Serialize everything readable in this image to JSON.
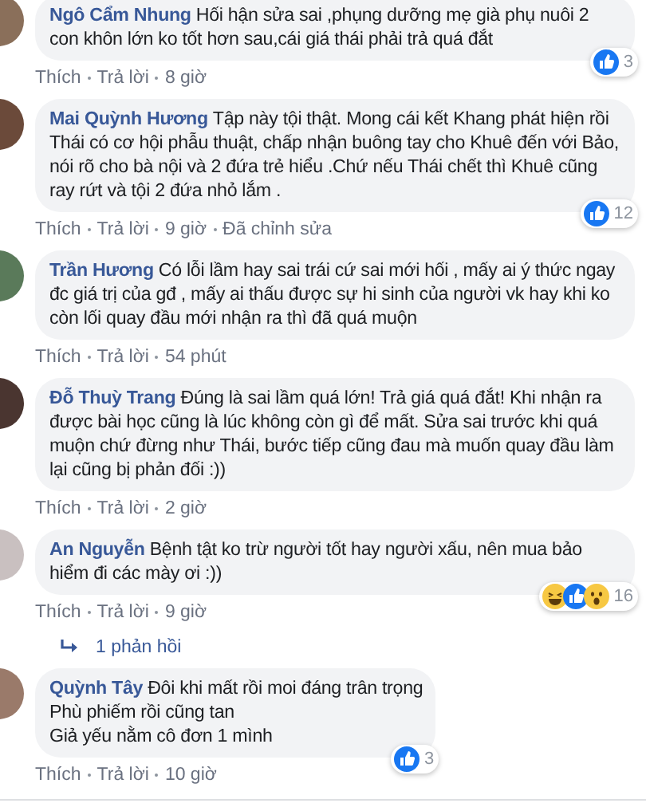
{
  "comments": [
    {
      "author": "Ngô Cẩm Nhung",
      "text": "Hối hận sửa sai ,phụng dưỡng mẹ già phụ nuôi 2 con khôn lớn ko tốt hơn sau,cái giá thái phải trả quá đắt",
      "reactions": {
        "icons": [
          {
            "kind": "like"
          }
        ],
        "count": "3"
      },
      "actions": [
        "Thích",
        "Trả lời",
        "8 giờ"
      ]
    },
    {
      "author": "Mai Quỳnh Hương",
      "text": "Tập này tội thật. Mong cái kết Khang phát hiện rồi Thái có cơ hội phẫu thuật, chấp nhận buông tay cho Khuê đến với Bảo, nói rõ cho bà nội và 2 đứa trẻ hiểu .Chứ nếu Thái chết thì Khuê cũng ray rứt và tội 2 đứa nhỏ lắm .",
      "reactions": {
        "icons": [
          {
            "kind": "like"
          }
        ],
        "count": "12"
      },
      "actions": [
        "Thích",
        "Trả lời",
        "9 giờ",
        "Đã chỉnh sửa"
      ]
    },
    {
      "author": "Trần Hương",
      "text": "Có lỗi lầm hay sai trái cứ sai mới hối , mấy ai ý thức ngay đc giá trị của gđ , mấy ai thấu được sự hi sinh của người vk hay khi ko còn lối quay đầu mới nhận ra thì đã quá muộn",
      "actions": [
        "Thích",
        "Trả lời",
        "54 phút"
      ]
    },
    {
      "author": "Đỗ Thuỳ Trang",
      "text": "Đúng là sai lầm quá lớn! Trả giá quá đắt! Khi nhận ra được bài học cũng là lúc không còn gì để mất. Sửa sai trước khi quá muộn chứ đừng như Thái, bước tiếp cũng đau mà muốn quay đầu làm lại cũng bị phản đối :))",
      "actions": [
        "Thích",
        "Trả lời",
        "2 giờ"
      ]
    },
    {
      "author": "An Nguyễn",
      "text": "Bệnh tật ko trừ người tốt hay người xấu, nên mua bảo hiểm đi các mày ơi :))",
      "reactions": {
        "icons": [
          {
            "kind": "haha"
          },
          {
            "kind": "like"
          },
          {
            "kind": "wow"
          }
        ],
        "count": "16"
      },
      "actions": [
        "Thích",
        "Trả lời",
        "9 giờ"
      ],
      "replies": "1 phản hồi"
    },
    {
      "author": "Quỳnh Tây",
      "lines": [
        "Đôi khi mất rồi moi đáng trân trọng",
        "Phù phiếm rồi cũng tan",
        "Giả yếu nằm cô đơn 1 mình"
      ],
      "reactions": {
        "icons": [
          {
            "kind": "like"
          }
        ],
        "count": "3"
      },
      "actions": [
        "Thích",
        "Trả lời",
        "10 giờ"
      ]
    }
  ]
}
